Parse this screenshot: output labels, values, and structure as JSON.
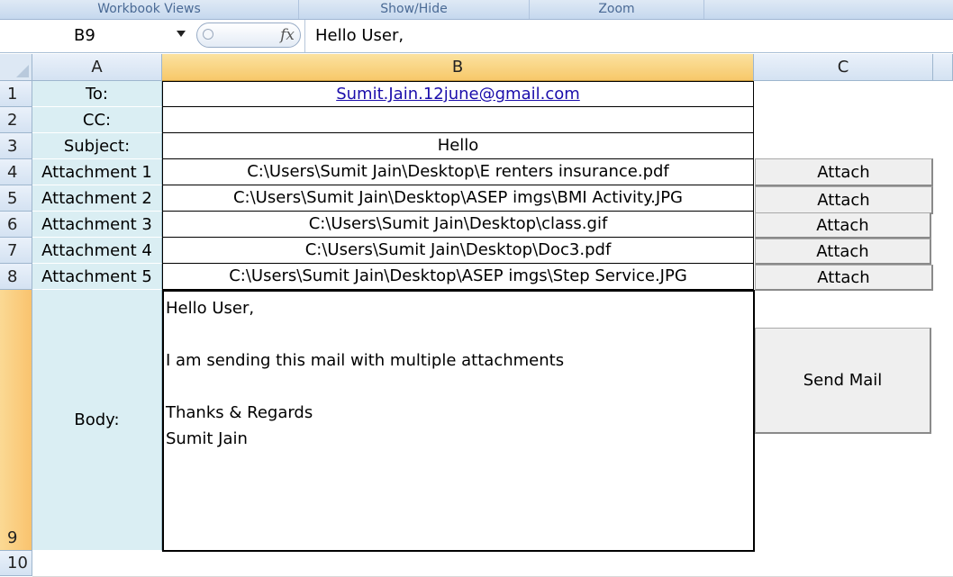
{
  "ribbon": {
    "groups": [
      "Workbook Views",
      "Show/Hide",
      "Zoom"
    ]
  },
  "formula_bar": {
    "name_box": "B9",
    "fx_label": "fx",
    "formula": "Hello User,"
  },
  "columns": [
    "A",
    "B",
    "C"
  ],
  "rows": [
    "1",
    "2",
    "3",
    "4",
    "5",
    "6",
    "7",
    "8",
    "9",
    "10"
  ],
  "sheet": {
    "labels": [
      "To:",
      "CC:",
      "Subject:",
      "Attachment 1",
      "Attachment 2",
      "Attachment 3",
      "Attachment 4",
      "Attachment 5",
      "Body:"
    ],
    "to": "Sumit.Jain.12june@gmail.com",
    "cc": "",
    "subject": "Hello",
    "attachments": [
      "C:\\Users\\Sumit Jain\\Desktop\\E renters insurance.pdf",
      "C:\\Users\\Sumit Jain\\Desktop\\ASEP imgs\\BMI Activity.JPG",
      "C:\\Users\\Sumit Jain\\Desktop\\class.gif",
      "C:\\Users\\Sumit Jain\\Desktop\\Doc3.pdf",
      "C:\\Users\\Sumit Jain\\Desktop\\ASEP imgs\\Step Service.JPG"
    ],
    "body": "Hello User,\n\nI am sending this mail with multiple attachments\n\nThanks & Regards\nSumit Jain"
  },
  "buttons": {
    "attach_label": "Attach",
    "send_label": "Send Mail"
  }
}
